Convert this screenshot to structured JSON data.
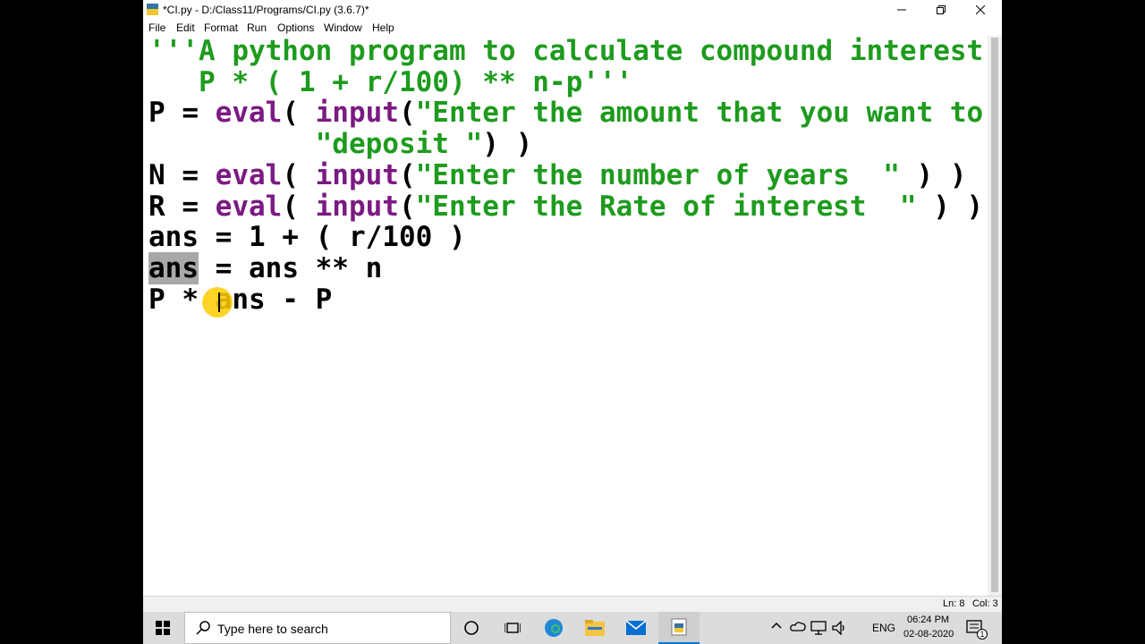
{
  "window": {
    "title": "*CI.py - D:/Class11/Programs/CI.py (3.6.7)*",
    "menus": [
      "File",
      "Edit",
      "Format",
      "Run",
      "Options",
      "Window",
      "Help"
    ]
  },
  "editor": {
    "lines": [
      {
        "segments": [
          {
            "text": "'''A python program to calculate compound interest",
            "cls": "str"
          }
        ]
      },
      {
        "segments": [
          {
            "text": "   P * ( 1 + r/100) ** n-p'''",
            "cls": "str"
          }
        ]
      },
      {
        "segments": [
          {
            "text": "P = ",
            "cls": ""
          },
          {
            "text": "eval",
            "cls": "kw"
          },
          {
            "text": "( ",
            "cls": ""
          },
          {
            "text": "input",
            "cls": "kw"
          },
          {
            "text": "(",
            "cls": ""
          },
          {
            "text": "\"Enter the amount that you want to",
            "cls": "str"
          }
        ]
      },
      {
        "segments": [
          {
            "text": "          ",
            "cls": ""
          },
          {
            "text": "\"deposit \"",
            "cls": "str"
          },
          {
            "text": ") )",
            "cls": ""
          }
        ]
      },
      {
        "segments": [
          {
            "text": "N = ",
            "cls": ""
          },
          {
            "text": "eval",
            "cls": "kw"
          },
          {
            "text": "( ",
            "cls": ""
          },
          {
            "text": "input",
            "cls": "kw"
          },
          {
            "text": "(",
            "cls": ""
          },
          {
            "text": "\"Enter the number of years  \"",
            "cls": "str"
          },
          {
            "text": " ) )",
            "cls": ""
          }
        ]
      },
      {
        "segments": [
          {
            "text": "R = ",
            "cls": ""
          },
          {
            "text": "eval",
            "cls": "kw"
          },
          {
            "text": "( ",
            "cls": ""
          },
          {
            "text": "input",
            "cls": "kw"
          },
          {
            "text": "(",
            "cls": ""
          },
          {
            "text": "\"Enter the Rate of interest  \"",
            "cls": "str"
          },
          {
            "text": " ) )",
            "cls": ""
          }
        ]
      },
      {
        "segments": [
          {
            "text": "ans = 1 + ( r/100 )",
            "cls": ""
          }
        ]
      },
      {
        "segments": [
          {
            "text": "ans",
            "cls": "sel"
          },
          {
            "text": " = ans ** n",
            "cls": ""
          }
        ]
      },
      {
        "segments": [
          {
            "text": "P * ans - P",
            "cls": ""
          }
        ]
      }
    ]
  },
  "status": {
    "line": "Ln: 8",
    "col": "Col: 3"
  },
  "taskbar": {
    "search_placeholder": "Type here to search",
    "language": "ENG",
    "time": "06:24 PM",
    "date": "02-08-2020",
    "notification_count": "1"
  },
  "colors": {
    "keyword": "#7b1a82",
    "string": "#1e9b1e",
    "selection": "#a8a8a8",
    "cursor_highlight": "#ffcc00"
  },
  "icons": [
    "python-idle-icon",
    "minimize-icon",
    "maximize-icon",
    "close-icon",
    "windows-start-icon",
    "search-icon",
    "cortana-icon",
    "task-view-icon",
    "edge-icon",
    "file-explorer-icon",
    "mail-icon",
    "python-idle-icon",
    "chevron-up-icon",
    "onedrive-icon",
    "network-icon",
    "volume-icon",
    "notification-icon"
  ]
}
